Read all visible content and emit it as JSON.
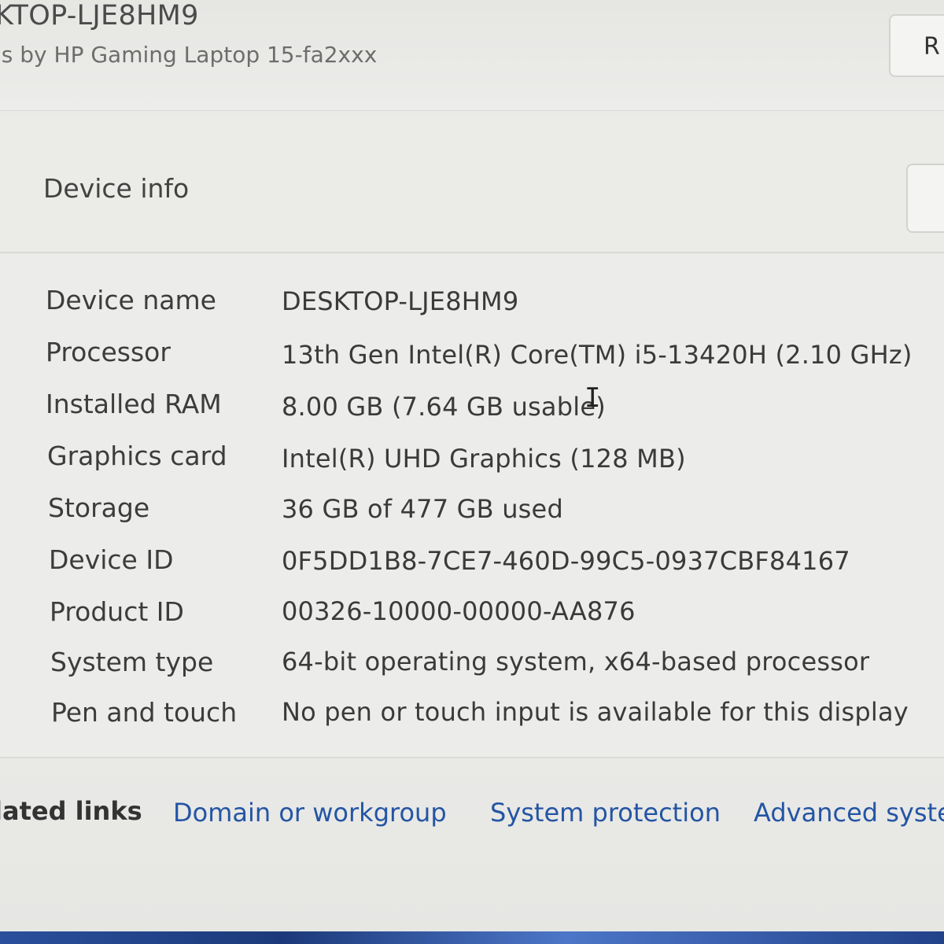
{
  "header": {
    "device_title": "KTOP-LJE8HM9",
    "device_subtitle": "is by HP Gaming Laptop 15-fa2xxx",
    "rename_label": "R"
  },
  "device_info": {
    "title": "Device info",
    "rows": [
      {
        "label": "Device name",
        "value": "DESKTOP-LJE8HM9"
      },
      {
        "label": "Processor",
        "value": "13th Gen Intel(R) Core(TM) i5-13420H (2.10 GHz)"
      },
      {
        "label": "Installed RAM",
        "value": "8.00 GB (7.64 GB usable)"
      },
      {
        "label": "Graphics card",
        "value": "Intel(R) UHD Graphics (128 MB)"
      },
      {
        "label": "Storage",
        "value": "36 GB of 477 GB used"
      },
      {
        "label": "Device ID",
        "value": "0F5DD1B8-7CE7-460D-99C5-0937CBF84167"
      },
      {
        "label": "Product ID",
        "value": "00326-10000-00000-AA876"
      },
      {
        "label": "System type",
        "value": "64-bit operating system, x64-based processor"
      },
      {
        "label": "Pen and touch",
        "value": "No pen or touch input is available for this display"
      }
    ]
  },
  "related_links": {
    "label": "lated links",
    "links": [
      "Domain or workgroup",
      "System protection",
      "Advanced syste"
    ]
  },
  "colors": {
    "link": "#2455a4",
    "background": "#ececea"
  }
}
